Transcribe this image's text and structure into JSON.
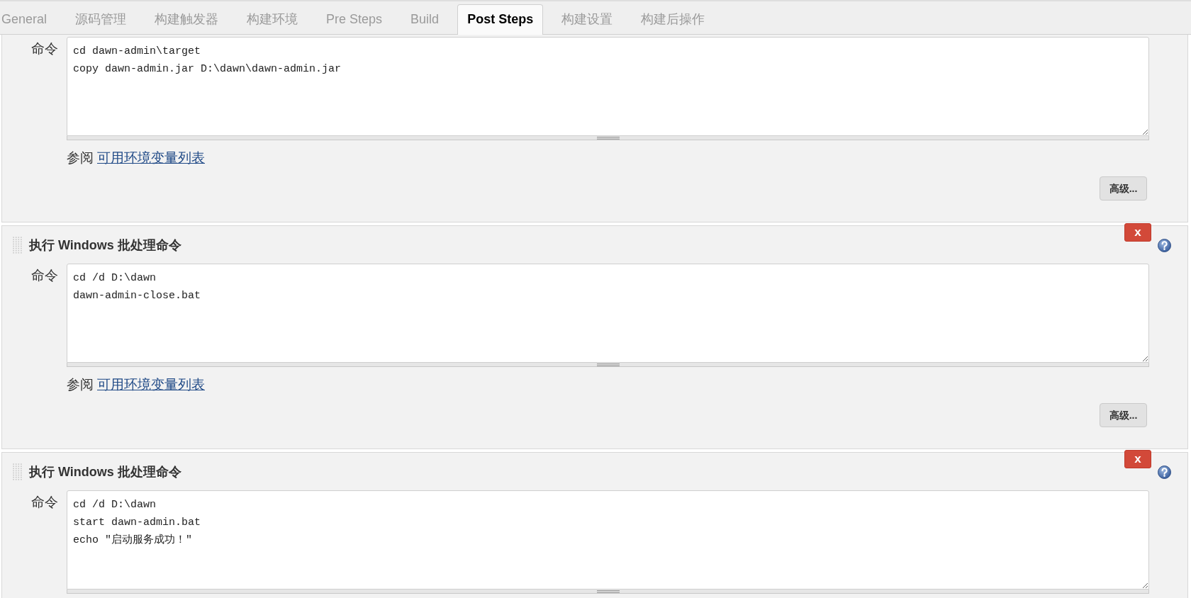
{
  "tabs": [
    {
      "label": "General",
      "selected": false
    },
    {
      "label": "源码管理",
      "selected": false
    },
    {
      "label": "构建触发器",
      "selected": false
    },
    {
      "label": "构建环境",
      "selected": false
    },
    {
      "label": "Pre Steps",
      "selected": false
    },
    {
      "label": "Build",
      "selected": false
    },
    {
      "label": "Post Steps",
      "selected": true
    },
    {
      "label": "构建设置",
      "selected": false
    },
    {
      "label": "构建后操作",
      "selected": false
    }
  ],
  "steps": [
    {
      "command_label": "命令",
      "command": "cd dawn-admin\\target\ncopy dawn-admin.jar D:\\dawn\\dawn-admin.jar",
      "see_also": "参阅",
      "see_also_link": "可用环境变量列表",
      "advanced_button": "高级..."
    },
    {
      "title": "执行 Windows 批处理命令",
      "delete_button": "x",
      "command_label": "命令",
      "command": "cd /d D:\\dawn\ndawn-admin-close.bat",
      "see_also": "参阅",
      "see_also_link": "可用环境变量列表",
      "advanced_button": "高级..."
    },
    {
      "title": "执行 Windows 批处理命令",
      "delete_button": "x",
      "command_label": "命令",
      "command": "cd /d D:\\dawn\nstart dawn-admin.bat\necho \"启动服务成功！\""
    }
  ]
}
